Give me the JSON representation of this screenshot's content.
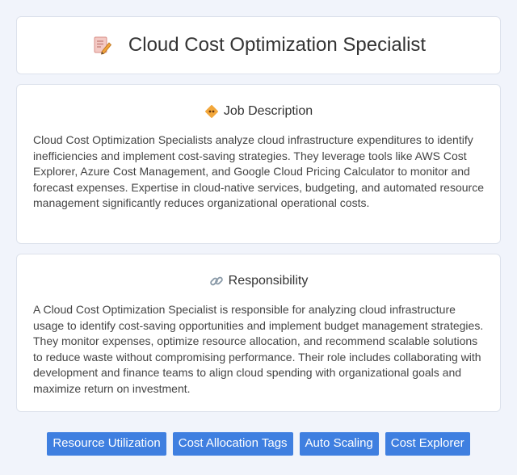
{
  "header": {
    "title": "Cloud Cost Optimization Specialist",
    "icon": "document-pencil-icon"
  },
  "job_description": {
    "heading": "Job Description",
    "icon": "diamond-badge-icon",
    "text": "Cloud Cost Optimization Specialists analyze cloud infrastructure expenditures to identify inefficiencies and implement cost-saving strategies. They leverage tools like AWS Cost Explorer, Azure Cost Management, and Google Cloud Pricing Calculator to monitor and forecast expenses. Expertise in cloud-native services, budgeting, and automated resource management significantly reduces organizational operational costs."
  },
  "responsibility": {
    "heading": "Responsibility",
    "icon": "link-icon",
    "text": "A Cloud Cost Optimization Specialist is responsible for analyzing cloud infrastructure usage to identify cost-saving opportunities and implement budget management strategies. They monitor expenses, optimize resource allocation, and recommend scalable solutions to reduce waste without compromising performance. Their role includes collaborating with development and finance teams to align cloud spending with organizational goals and maximize return on investment."
  },
  "tags": [
    "Resource Utilization",
    "Cost Allocation Tags",
    "Auto Scaling",
    "Cost Explorer"
  ],
  "colors": {
    "background": "#f1f4fb",
    "tag": "#3f7fe0",
    "card": "#ffffff"
  }
}
